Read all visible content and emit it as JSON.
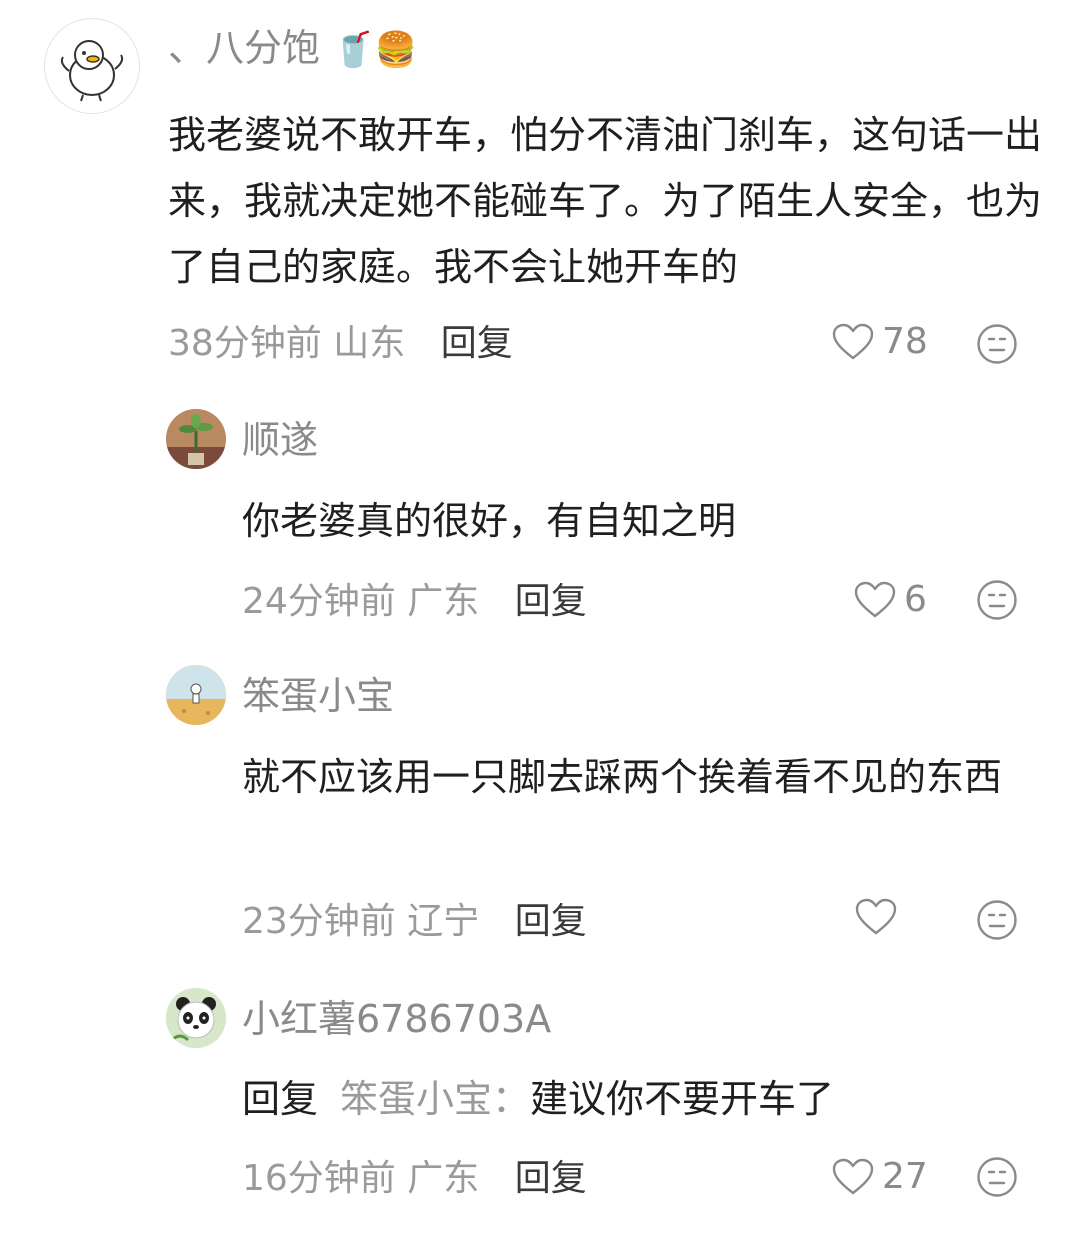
{
  "comments": [
    {
      "username": "、八分饱",
      "username_emoji": "🥤🍔",
      "content": "我老婆说不敢开车，怕分不清油门刹车，这句话一出来，我就决定她不能碰车了。为了陌生人安全，也为了自己的家庭。我不会让她开车的",
      "time": "38分钟前",
      "location": "山东",
      "reply_label": "回复",
      "likes": "78"
    },
    {
      "username": "顺遂",
      "content": "你老婆真的很好，有自知之明",
      "time": "24分钟前",
      "location": "广东",
      "reply_label": "回复",
      "likes": "6"
    },
    {
      "username": "笨蛋小宝",
      "content": "就不应该用一只脚去踩两个挨着看不见的东西",
      "time": "23分钟前",
      "location": "辽宁",
      "reply_label": "回复",
      "likes": ""
    },
    {
      "username": "小红薯6786703A",
      "reply_prefix": "回复",
      "reply_target": "笨蛋小宝：",
      "content": "建议你不要开车了",
      "time": "16分钟前",
      "location": "广东",
      "reply_label": "回复",
      "likes": "27"
    }
  ],
  "icons": {
    "like": "heart-outline-icon",
    "more": "neutral-face-icon"
  },
  "colors": {
    "text_primary": "#1f1f1f",
    "text_secondary": "#9a9a9a",
    "username": "#8a8a8a"
  }
}
